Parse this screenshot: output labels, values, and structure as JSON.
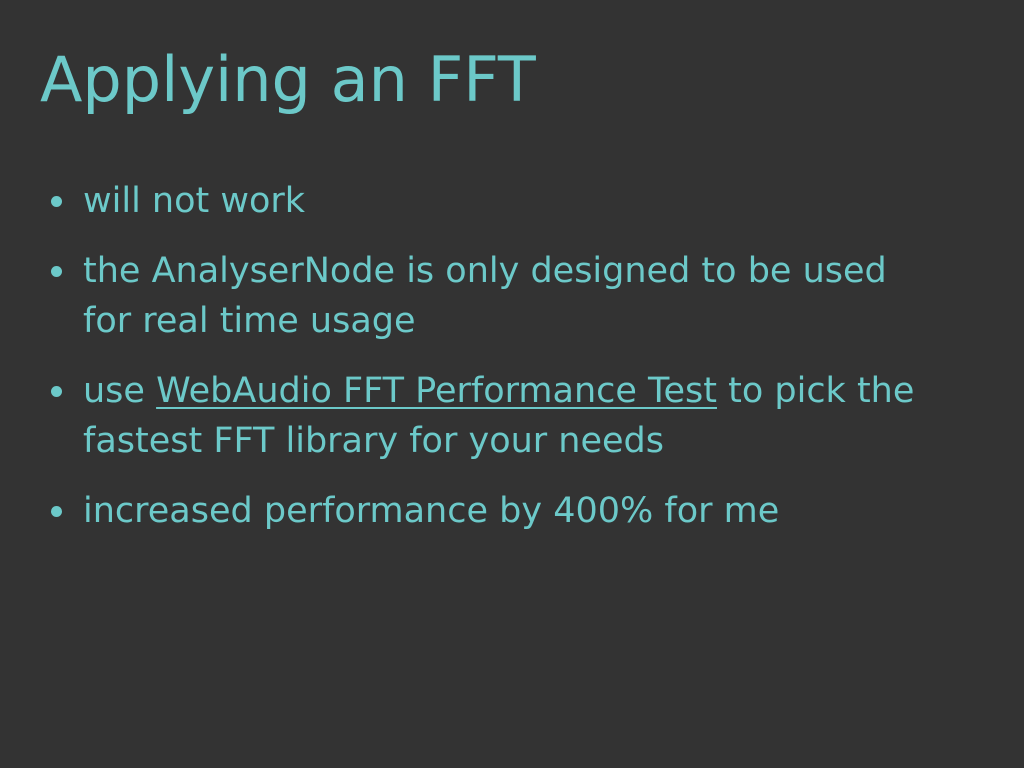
{
  "slide": {
    "title": "Applying an FFT",
    "bullets": [
      {
        "text": "will not work"
      },
      {
        "text": "the AnalyserNode is only designed to be used for real time usage"
      },
      {
        "prefix": "use ",
        "link": "WebAudio FFT Performance Test",
        "suffix": " to pick the fastest FFT library for your needs"
      },
      {
        "text": "increased performance by 400% for me"
      }
    ]
  },
  "colors": {
    "background": "#333333",
    "text": "#6cc9c9"
  }
}
